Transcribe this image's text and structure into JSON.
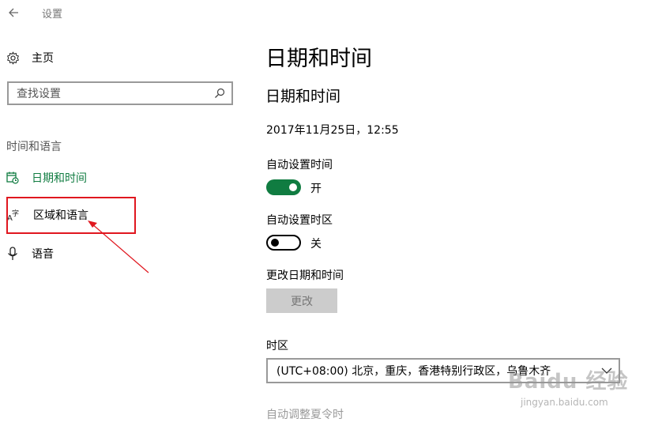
{
  "window": {
    "title": "设置"
  },
  "sidebar": {
    "home_label": "主页",
    "search_placeholder": "查找设置",
    "section_label": "时间和语言",
    "items": [
      {
        "label": "日期和时间",
        "icon": "calendar-clock-icon",
        "active": true
      },
      {
        "label": "区域和语言",
        "icon": "language-icon",
        "active": false
      },
      {
        "label": "语音",
        "icon": "microphone-icon",
        "active": false
      }
    ]
  },
  "main": {
    "page_title": "日期和时间",
    "section_title": "日期和时间",
    "current_datetime": "2017年11月25日，12:55",
    "auto_time": {
      "label": "自动设置时间",
      "state": "开",
      "on": true
    },
    "auto_zone": {
      "label": "自动设置时区",
      "state": "关",
      "on": false
    },
    "change": {
      "label": "更改日期和时间",
      "button": "更改"
    },
    "timezone": {
      "label": "时区",
      "value": "(UTC+08:00) 北京，重庆，香港特别行政区，乌鲁木齐"
    },
    "dst_label": "自动调整夏令时"
  },
  "watermark": {
    "main": "Baidu 经验",
    "sub": "jingyan.baidu.com"
  },
  "colors": {
    "accent": "#107c41",
    "highlight": "#e0171f"
  }
}
